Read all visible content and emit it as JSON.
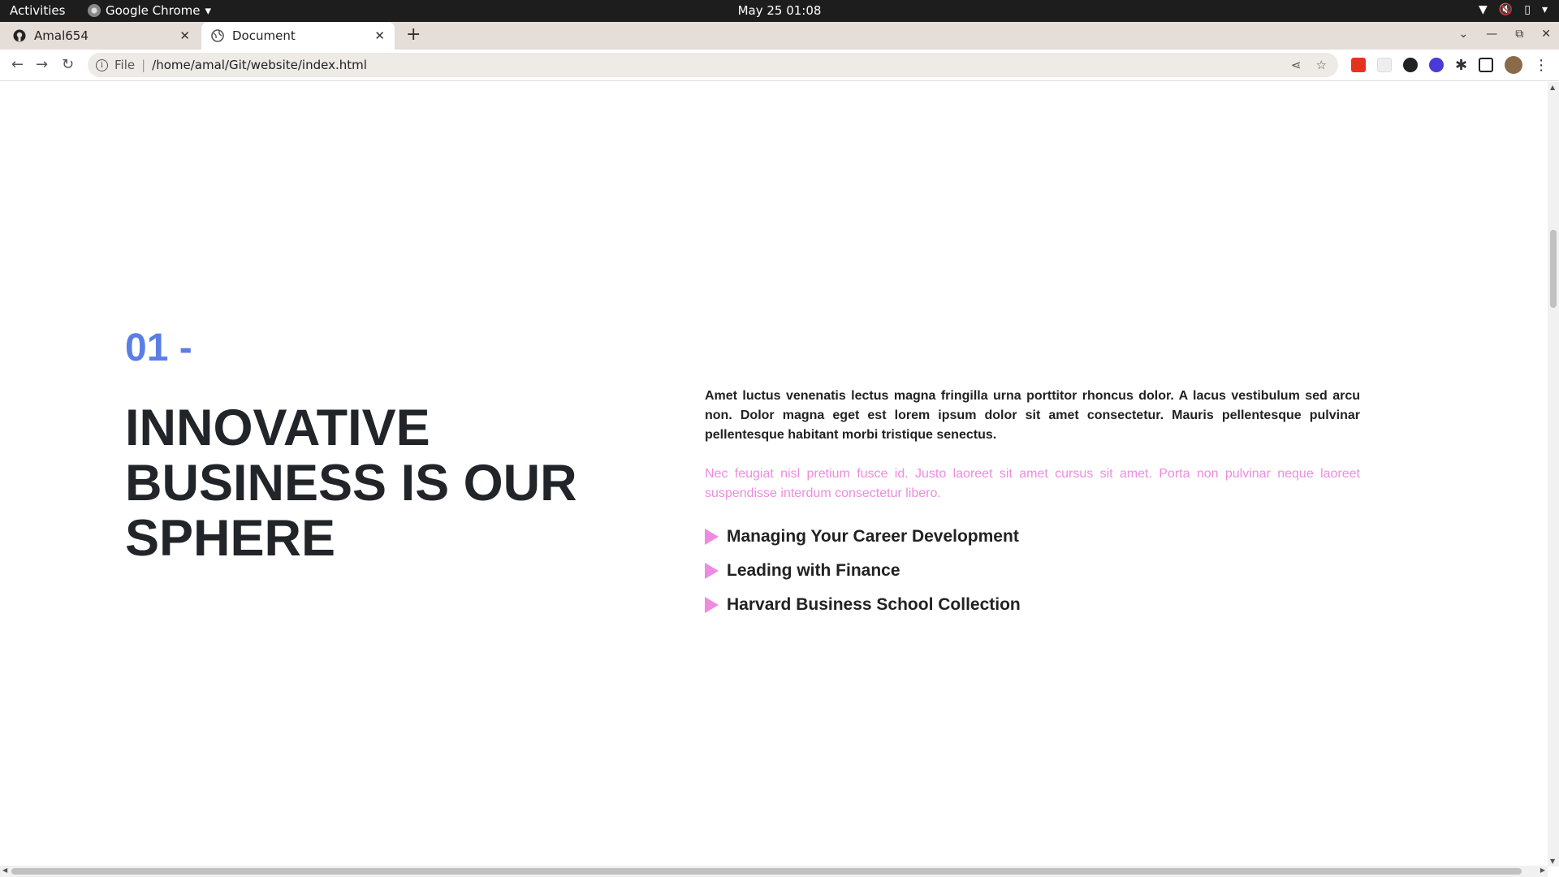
{
  "os_bar": {
    "activities": "Activities",
    "app_name": "Google Chrome",
    "clock": "May 25  01:08"
  },
  "tabs": [
    {
      "title": "Amal654",
      "icon": "github-icon",
      "active": false
    },
    {
      "title": "Document",
      "icon": "globe-icon",
      "active": true
    }
  ],
  "address_bar": {
    "scheme": "File",
    "url": "/home/amal/Git/website/index.html"
  },
  "page": {
    "number": "01 -",
    "headline": "INNOVATIVE BUSINESS IS OUR SPHERE",
    "paragraph1": "Amet luctus venenatis lectus magna fringilla urna porttitor rhoncus dolor. A lacus vestibulum sed arcu non. Dolor magna eget est lorem ipsum dolor sit amet consectetur. Mauris pellentesque pulvinar pellentesque habitant morbi tristique senectus.",
    "paragraph2": "Nec feugiat nisl pretium fusce id. Justo laoreet sit amet cursus sit amet. Porta non pulvinar neque laoreet suspendisse interdum consectetur libero.",
    "list": [
      "Managing Your Career Development",
      "Leading with Finance",
      "Harvard Business School Collection"
    ]
  },
  "colors": {
    "accent_blue": "#5b7ee6",
    "accent_pink": "#ee8be0",
    "heading": "#212529"
  }
}
